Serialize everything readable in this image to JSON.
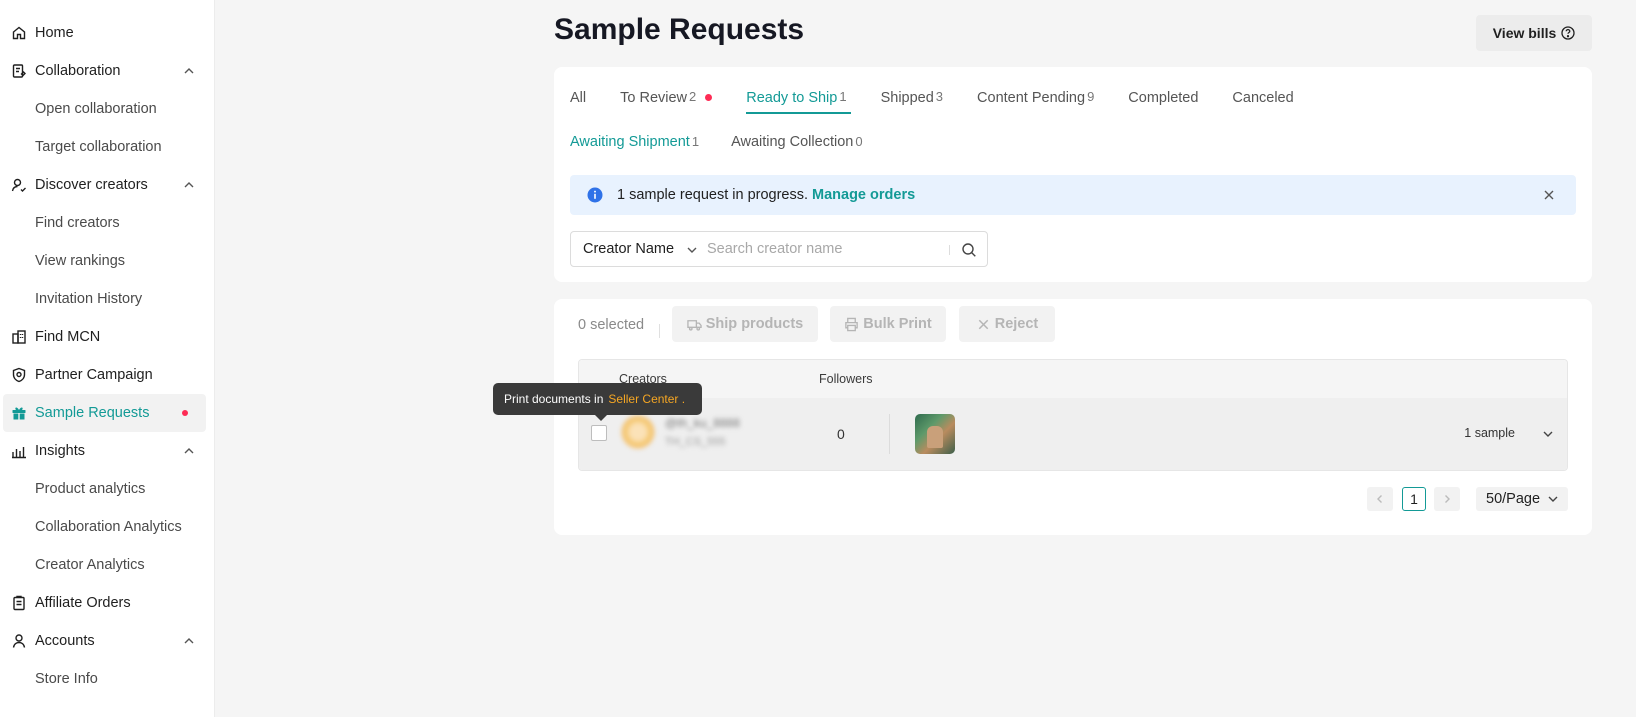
{
  "sidebar": {
    "items": [
      {
        "label": "Home",
        "icon": "home-icon"
      },
      {
        "label": "Collaboration",
        "icon": "collaboration-icon"
      },
      {
        "label": "Open collaboration"
      },
      {
        "label": "Target collaboration"
      },
      {
        "label": "Discover creators",
        "icon": "user-search-icon"
      },
      {
        "label": "Find creators"
      },
      {
        "label": "View rankings"
      },
      {
        "label": "Invitation History"
      },
      {
        "label": "Find MCN",
        "icon": "building-icon"
      },
      {
        "label": "Partner Campaign",
        "icon": "shield-icon"
      },
      {
        "label": "Sample Requests",
        "icon": "gift-icon"
      },
      {
        "label": "Insights",
        "icon": "chart-icon"
      },
      {
        "label": "Product analytics"
      },
      {
        "label": "Collaboration Analytics"
      },
      {
        "label": "Creator Analytics"
      },
      {
        "label": "Affiliate Orders",
        "icon": "clipboard-icon"
      },
      {
        "label": "Accounts",
        "icon": "user-icon"
      },
      {
        "label": "Store Info"
      }
    ]
  },
  "header": {
    "title": "Sample Requests",
    "view_bills": "View bills"
  },
  "tabs": [
    {
      "label": "All",
      "count": ""
    },
    {
      "label": "To Review",
      "count": "2"
    },
    {
      "label": "Ready to Ship",
      "count": "1"
    },
    {
      "label": "Shipped",
      "count": "3"
    },
    {
      "label": "Content Pending",
      "count": "9"
    },
    {
      "label": "Completed",
      "count": ""
    },
    {
      "label": "Canceled",
      "count": ""
    }
  ],
  "subtabs": [
    {
      "label": "Awaiting Shipment",
      "count": "1"
    },
    {
      "label": "Awaiting Collection",
      "count": "0"
    }
  ],
  "banner": {
    "text": "1 sample request in progress.",
    "link": "Manage orders"
  },
  "search": {
    "field": "Creator Name",
    "placeholder": "Search creator name"
  },
  "toolbar": {
    "selected": "0 selected",
    "ship": "Ship products",
    "print": "Bulk Print",
    "reject": "Reject"
  },
  "table": {
    "headers": {
      "creators": "Creators",
      "followers": "Followers"
    },
    "rows": [
      {
        "name": "@th_ku_8888",
        "handle": "TH_CS_555",
        "followers": "0",
        "samples": "1 sample"
      }
    ]
  },
  "pagination": {
    "page": "1",
    "per_page": "50/Page"
  },
  "tooltip": {
    "text": "Print documents in",
    "link": "Seller Center ."
  },
  "colors": {
    "accent": "#139a96",
    "alert_dot": "#fe2c55",
    "tooltip_link": "#f5a623",
    "banner_bg": "#e8f2fe"
  }
}
